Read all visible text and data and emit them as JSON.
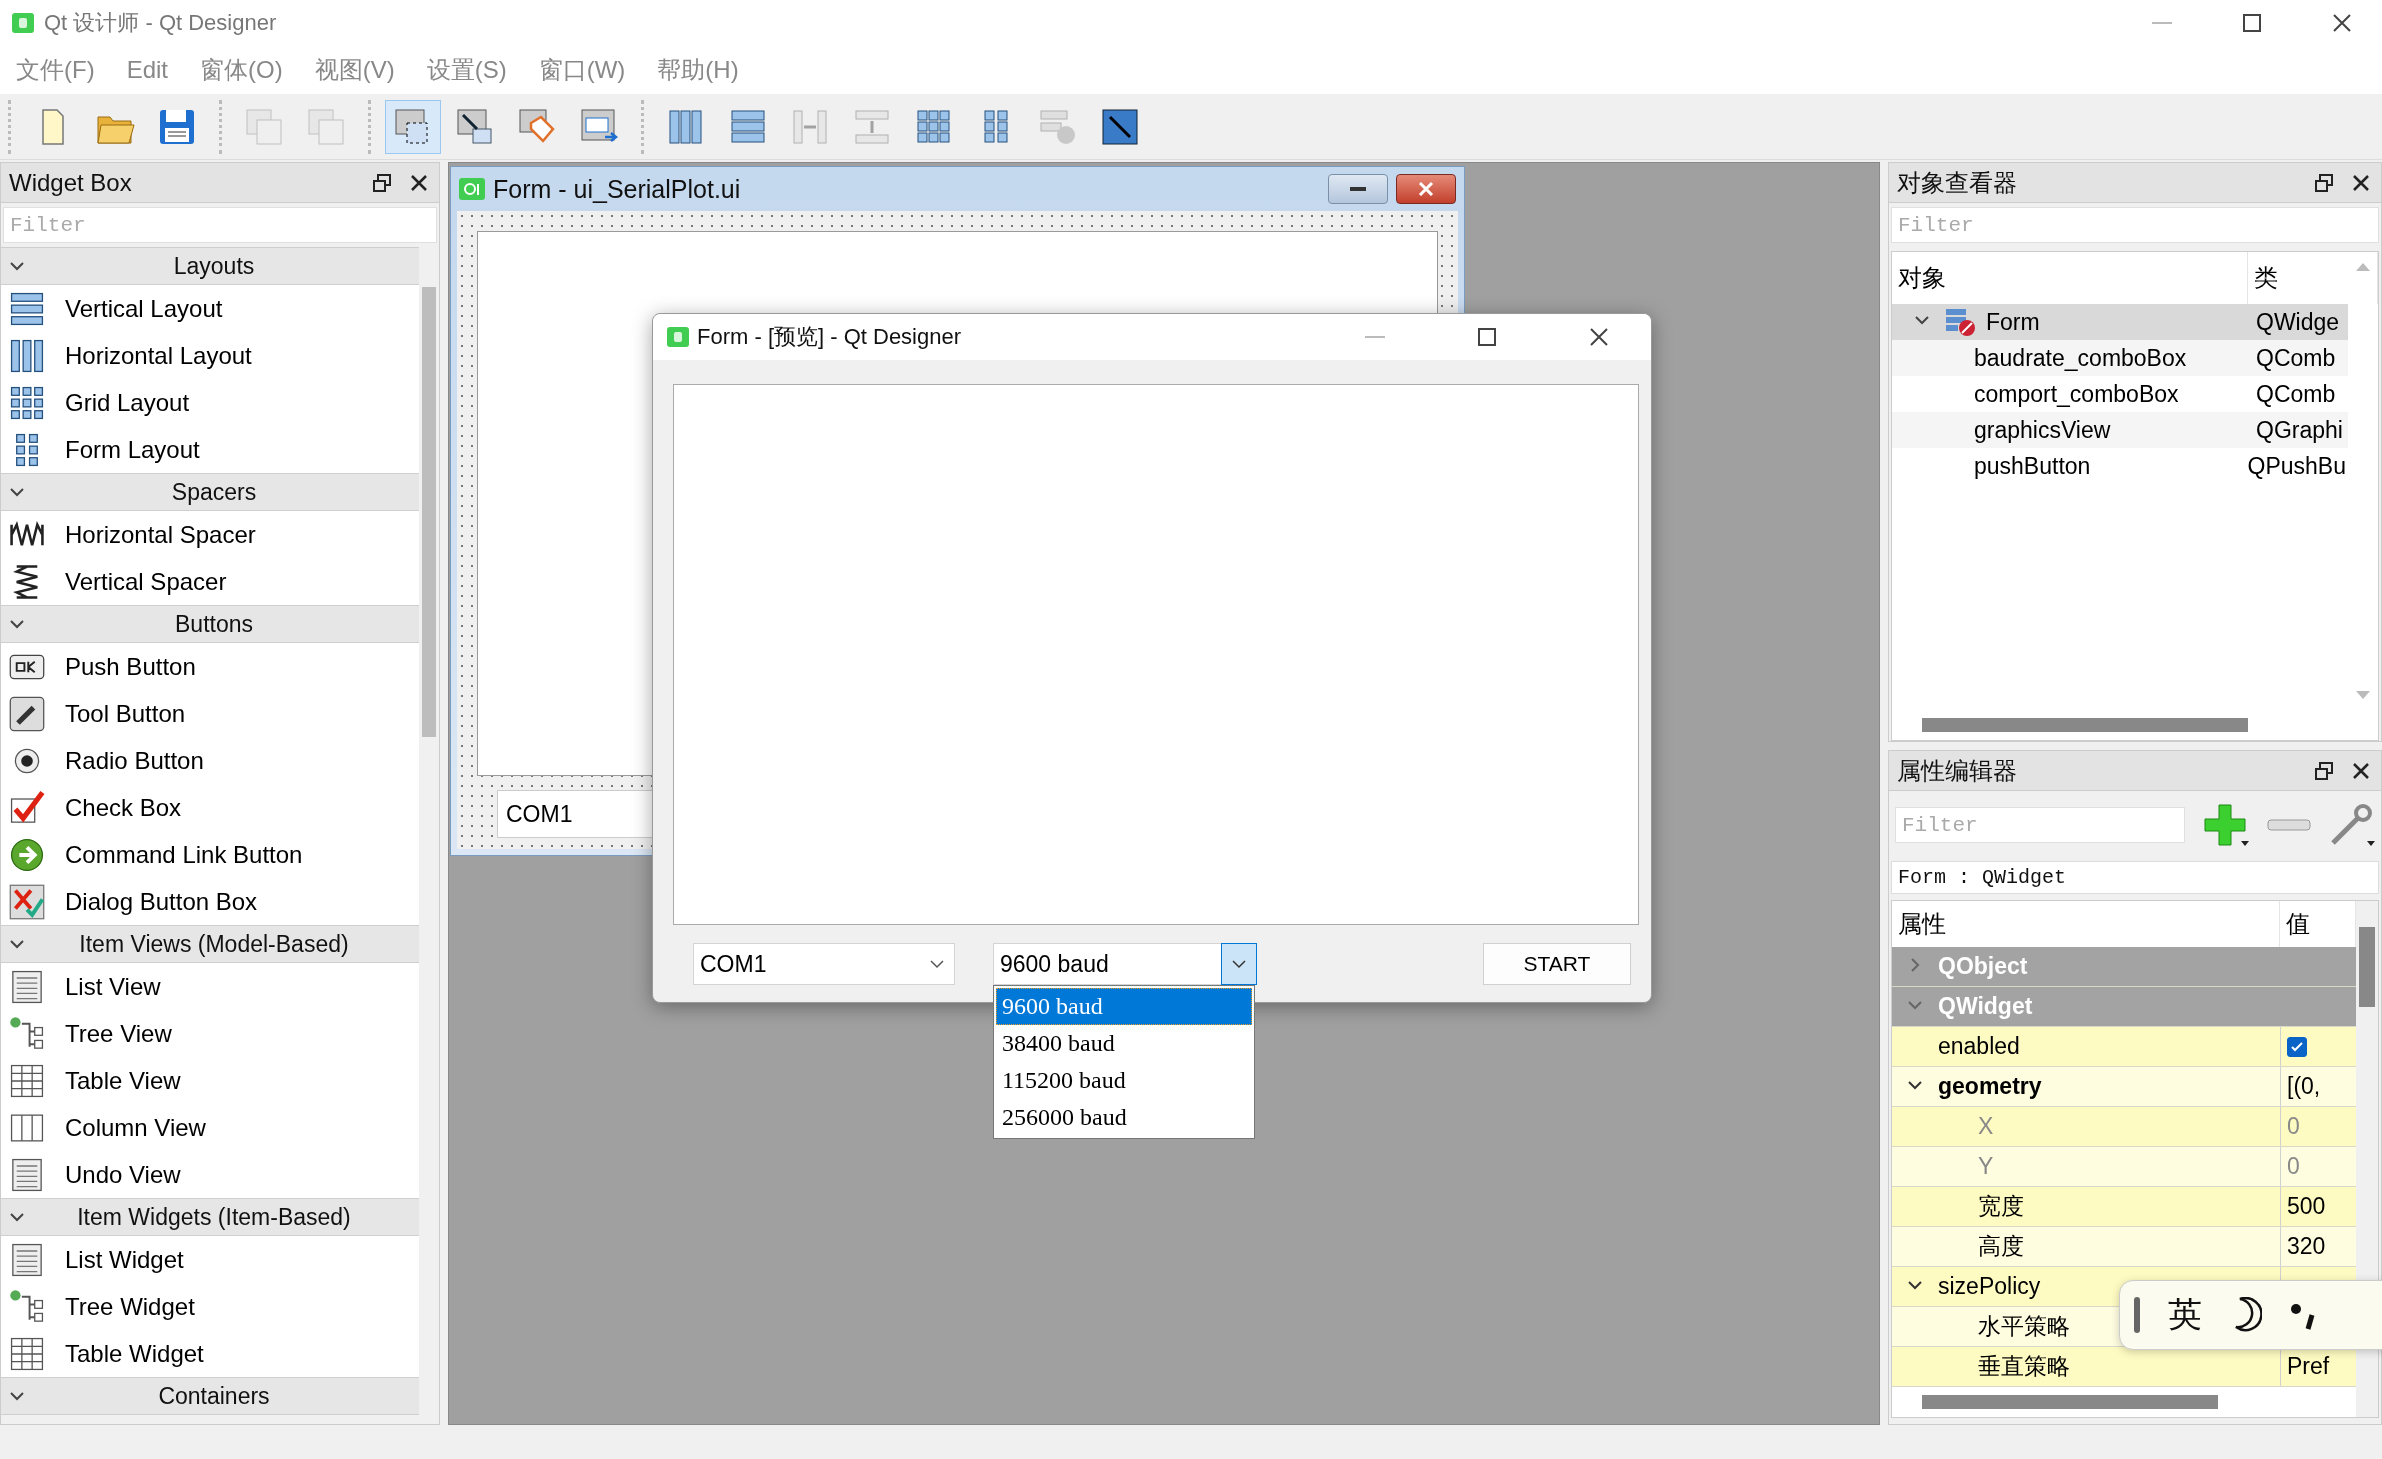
{
  "window": {
    "title": "Qt 设计师 - Qt Designer"
  },
  "menu": [
    "文件(F)",
    "Edit",
    "窗体(O)",
    "视图(V)",
    "设置(S)",
    "窗口(W)",
    "帮助(H)"
  ],
  "toolbar": {
    "groups": [
      {
        "buttons": [
          {
            "kind": "new",
            "selected": false,
            "disabled": false
          },
          {
            "kind": "open",
            "selected": false,
            "disabled": false
          },
          {
            "kind": "save",
            "selected": false,
            "disabled": false
          }
        ]
      },
      {
        "buttons": [
          {
            "kind": "front",
            "selected": false,
            "disabled": true
          },
          {
            "kind": "back",
            "selected": false,
            "disabled": true
          }
        ]
      },
      {
        "buttons": [
          {
            "kind": "edit-widgets",
            "selected": true,
            "disabled": false
          },
          {
            "kind": "edit-signals",
            "selected": false,
            "disabled": false
          },
          {
            "kind": "edit-buddies",
            "selected": false,
            "disabled": false
          },
          {
            "kind": "edit-taborder",
            "selected": false,
            "disabled": false
          }
        ]
      },
      {
        "buttons": [
          {
            "kind": "layout-h",
            "selected": false,
            "disabled": false
          },
          {
            "kind": "layout-v",
            "selected": false,
            "disabled": false
          },
          {
            "kind": "split-h",
            "selected": false,
            "disabled": true
          },
          {
            "kind": "split-v",
            "selected": false,
            "disabled": true
          },
          {
            "kind": "layout-grid",
            "selected": false,
            "disabled": false
          },
          {
            "kind": "layout-form",
            "selected": false,
            "disabled": false
          },
          {
            "kind": "break",
            "selected": false,
            "disabled": true
          },
          {
            "kind": "adjust",
            "selected": false,
            "disabled": false
          }
        ]
      }
    ]
  },
  "widget_box": {
    "title": "Widget Box",
    "filter_placeholder": "Filter",
    "categories": [
      {
        "label": "Layouts",
        "expanded": true,
        "items": [
          {
            "label": "Vertical Layout",
            "kind": "vlayout"
          },
          {
            "label": "Horizontal Layout",
            "kind": "hlayout"
          },
          {
            "label": "Grid Layout",
            "kind": "grid"
          },
          {
            "label": "Form Layout",
            "kind": "form"
          }
        ]
      },
      {
        "label": "Spacers",
        "expanded": true,
        "items": [
          {
            "label": "Horizontal Spacer",
            "kind": "hspacer"
          },
          {
            "label": "Vertical Spacer",
            "kind": "vspacer"
          }
        ]
      },
      {
        "label": "Buttons",
        "expanded": true,
        "items": [
          {
            "label": "Push Button",
            "kind": "push"
          },
          {
            "label": "Tool Button",
            "kind": "tool"
          },
          {
            "label": "Radio Button",
            "kind": "radio"
          },
          {
            "label": "Check Box",
            "kind": "check"
          },
          {
            "label": "Command Link Button",
            "kind": "cmdlink"
          },
          {
            "label": "Dialog Button Box",
            "kind": "dialog"
          }
        ]
      },
      {
        "label": "Item Views (Model-Based)",
        "expanded": true,
        "items": [
          {
            "label": "List View",
            "kind": "list"
          },
          {
            "label": "Tree View",
            "kind": "tree"
          },
          {
            "label": "Table View",
            "kind": "table"
          },
          {
            "label": "Column View",
            "kind": "column"
          },
          {
            "label": "Undo View",
            "kind": "list"
          }
        ]
      },
      {
        "label": "Item Widgets (Item-Based)",
        "expanded": true,
        "items": [
          {
            "label": "List Widget",
            "kind": "list"
          },
          {
            "label": "Tree Widget",
            "kind": "tree"
          },
          {
            "label": "Table Widget",
            "kind": "table"
          }
        ]
      },
      {
        "label": "Containers",
        "expanded": true
      }
    ]
  },
  "form_window": {
    "title": "Form - ui_SerialPlot.ui",
    "combo_value": "COM1"
  },
  "preview": {
    "title": "Form - [预览] - Qt Designer",
    "port_combo": "COM1",
    "baud_combo": "9600 baud",
    "button": "START",
    "baud_options": [
      {
        "label": "9600 baud",
        "selected": true
      },
      {
        "label": "38400 baud",
        "selected": false
      },
      {
        "label": "115200 baud",
        "selected": false
      },
      {
        "label": "256000 baud",
        "selected": false
      }
    ]
  },
  "object_inspector": {
    "title": "对象查看器",
    "filter_placeholder": "Filter",
    "columns": [
      "对象",
      "类"
    ],
    "tree": [
      {
        "name": "Form",
        "class": "QWidge",
        "selected": true,
        "expanded": true,
        "children": [
          {
            "name": "baudrate_comboBox",
            "class": "QComb",
            "selected": false
          },
          {
            "name": "comport_comboBox",
            "class": "QComb",
            "selected": false
          },
          {
            "name": "graphicsView",
            "class": "QGraphi",
            "selected": false
          },
          {
            "name": "pushButton",
            "class": "QPushBu",
            "selected": false
          }
        ]
      }
    ]
  },
  "property_editor": {
    "title": "属性编辑器",
    "filter_placeholder": "Filter",
    "context": "Form : QWidget",
    "columns": [
      "属性",
      "值"
    ],
    "properties": [
      {
        "kind": "group",
        "name": "QObject",
        "expanded": false
      },
      {
        "kind": "group",
        "name": "QWidget",
        "expanded": true,
        "children": [
          {
            "kind": "check",
            "name": "enabled",
            "checked": true
          },
          {
            "kind": "value",
            "name": "geometry",
            "value": "[(0,",
            "modified": true,
            "expanded": true,
            "children": [
              {
                "kind": "value",
                "name": "X",
                "value": "0",
                "disabled": true
              },
              {
                "kind": "value",
                "name": "Y",
                "value": "0",
                "disabled": true
              },
              {
                "kind": "value",
                "name": "宽度",
                "value": "500"
              },
              {
                "kind": "value",
                "name": "高度",
                "value": "320"
              }
            ]
          },
          {
            "kind": "value",
            "name": "sizePolicy",
            "expanded": true,
            "children": [
              {
                "kind": "value",
                "name": "水平策略"
              },
              {
                "kind": "value",
                "name": "垂直策略",
                "value": "Pref"
              }
            ]
          }
        ]
      }
    ]
  },
  "ime_bar": {
    "label": "英"
  }
}
